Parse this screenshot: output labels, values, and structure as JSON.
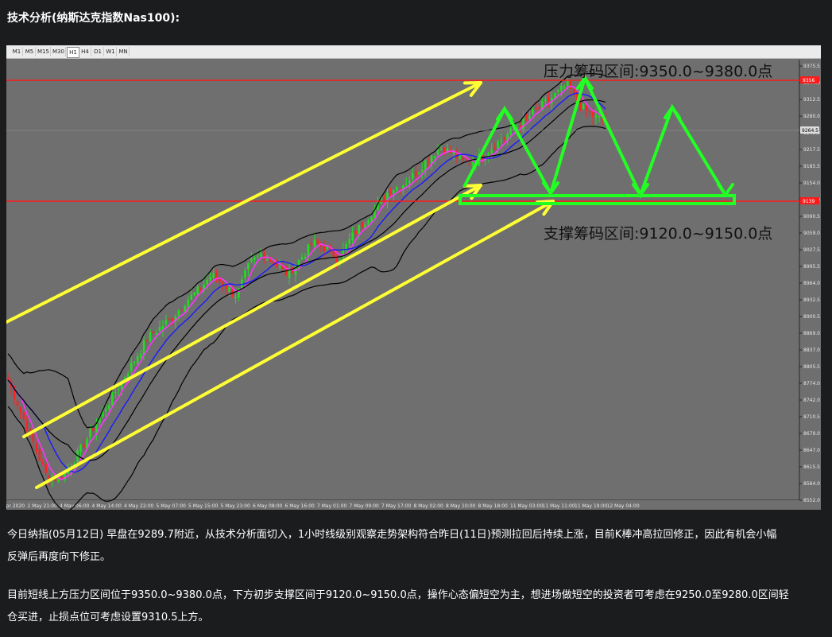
{
  "page_title": "技术分析(纳斯达克指数Nas100):",
  "toolbar": {
    "timeframes": [
      "M1",
      "M5",
      "M15",
      "M30",
      "H1",
      "H4",
      "D1",
      "W1",
      "MN"
    ],
    "active": "H1"
  },
  "chart_data": {
    "type": "candlestick",
    "instrument": "Nas100",
    "timeframe": "H1",
    "price_axis_labels": [
      "9375.5",
      "9344.0",
      "9312.5",
      "9280.0",
      "9249.0",
      "9217.5",
      "9185.5",
      "9154.0",
      "9122.0",
      "9090.5",
      "9059.0",
      "9027.5",
      "8995.5",
      "8964.0",
      "8932.5",
      "8900.5",
      "8869.0",
      "8837.0",
      "8805.5",
      "8774.0",
      "8742.0",
      "8710.5",
      "8679.0",
      "8647.0",
      "8615.5",
      "8584.0",
      "8552.0"
    ],
    "ylim": [
      8552.0,
      9375.5
    ],
    "current_price_label": "9264.5",
    "resistance_line_label": "9356",
    "support_line_label": "9139",
    "time_axis_labels": [
      "30 Apr 2020",
      "1 May 21:00",
      "4 May 06:00",
      "4 May 14:00",
      "4 May 22:00",
      "5 May 07:00",
      "5 May 15:00",
      "5 May 23:00",
      "6 May 08:00",
      "6 May 16:00",
      "7 May 01:00",
      "7 May 09:00",
      "7 May 17:00",
      "8 May 02:00",
      "8 May 10:00",
      "8 May 18:00",
      "11 May 03:00",
      "11 May 11:00",
      "11 May 19:00",
      "12 May 04:00"
    ],
    "close_path": [
      8780,
      8720,
      8660,
      8600,
      8590,
      8620,
      8660,
      8700,
      8740,
      8780,
      8820,
      8860,
      8880,
      8900,
      8930,
      8950,
      8980,
      8960,
      8940,
      9000,
      9020,
      9000,
      8980,
      9010,
      9040,
      9030,
      9010,
      9050,
      9080,
      9110,
      9140,
      9150,
      9170,
      9200,
      9220,
      9210,
      9190,
      9200,
      9220,
      9240,
      9260,
      9280,
      9300,
      9320,
      9340,
      9300,
      9280,
      9270
    ],
    "annotations": {
      "resistance": "压力筹码区间:9350.0~9380.0点",
      "support": "支撑筹码区间:9120.0~9150.0点"
    },
    "colors": {
      "background": "#6f6f6f",
      "bull": "#22dd22",
      "bear": "#ff2222",
      "ma_fast": "#ff33ff",
      "ma_slow": "#1a1aff",
      "bollinger": "#000000",
      "channel": "#ffff33",
      "pattern": "#22ff22",
      "level": "#ff1a1a"
    }
  },
  "paragraphs": {
    "p1_line1": "今日纳指(05月12日) 早盘在9289.7附近，从技术分析面切入，1小时线级别观察走势架构符合昨日(11日)预测拉回后持续上涨，目前K棒冲高拉回修正，因此有机会小幅",
    "p1_line2": "反弹后再度向下修正。",
    "p2_line1": "目前短线上方压力区间位于9350.0~9380.0点，下方初步支撑区间于9120.0~9150.0点，操作心态偏短空为主，想进场做短空的投资者可考虑在9250.0至9280.0区间轻",
    "p2_line2": "仓买进，止损点位可考虑设置9310.5上方。"
  }
}
